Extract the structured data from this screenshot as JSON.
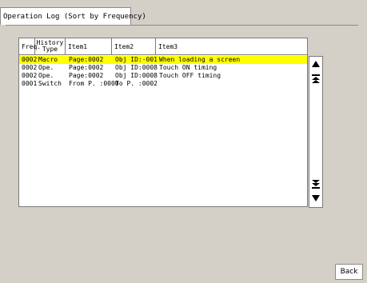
{
  "tab": {
    "title": "Operation Log (Sort by Frequency)"
  },
  "table": {
    "headers": {
      "freq": "Freq.",
      "history_type": "History Type",
      "item1": "Item1",
      "item2": "Item2",
      "item3": "Item3"
    },
    "rows": [
      {
        "freq": "0002",
        "type": "Macro",
        "item1": "Page:0002",
        "item2": "Obj ID:-001",
        "item3": "When loading a screen",
        "selected": true
      },
      {
        "freq": "0002",
        "type": "Ope.",
        "item1": "Page:0002",
        "item2": "Obj ID:0008",
        "item3": "Touch ON timing",
        "selected": false
      },
      {
        "freq": "0002",
        "type": "Ope.",
        "item1": "Page:0002",
        "item2": "Obj ID:0008",
        "item3": "Touch OFF timing",
        "selected": false
      },
      {
        "freq": "0001",
        "type": "Switch",
        "item1": "From P. :0000",
        "item2": "To P. :0002",
        "item3": "",
        "selected": false
      }
    ]
  },
  "scrollbar": {
    "icons": [
      "scroll-up-icon",
      "page-up-icon",
      "page-down-icon",
      "scroll-down-icon"
    ]
  },
  "buttons": {
    "back": "Back"
  }
}
